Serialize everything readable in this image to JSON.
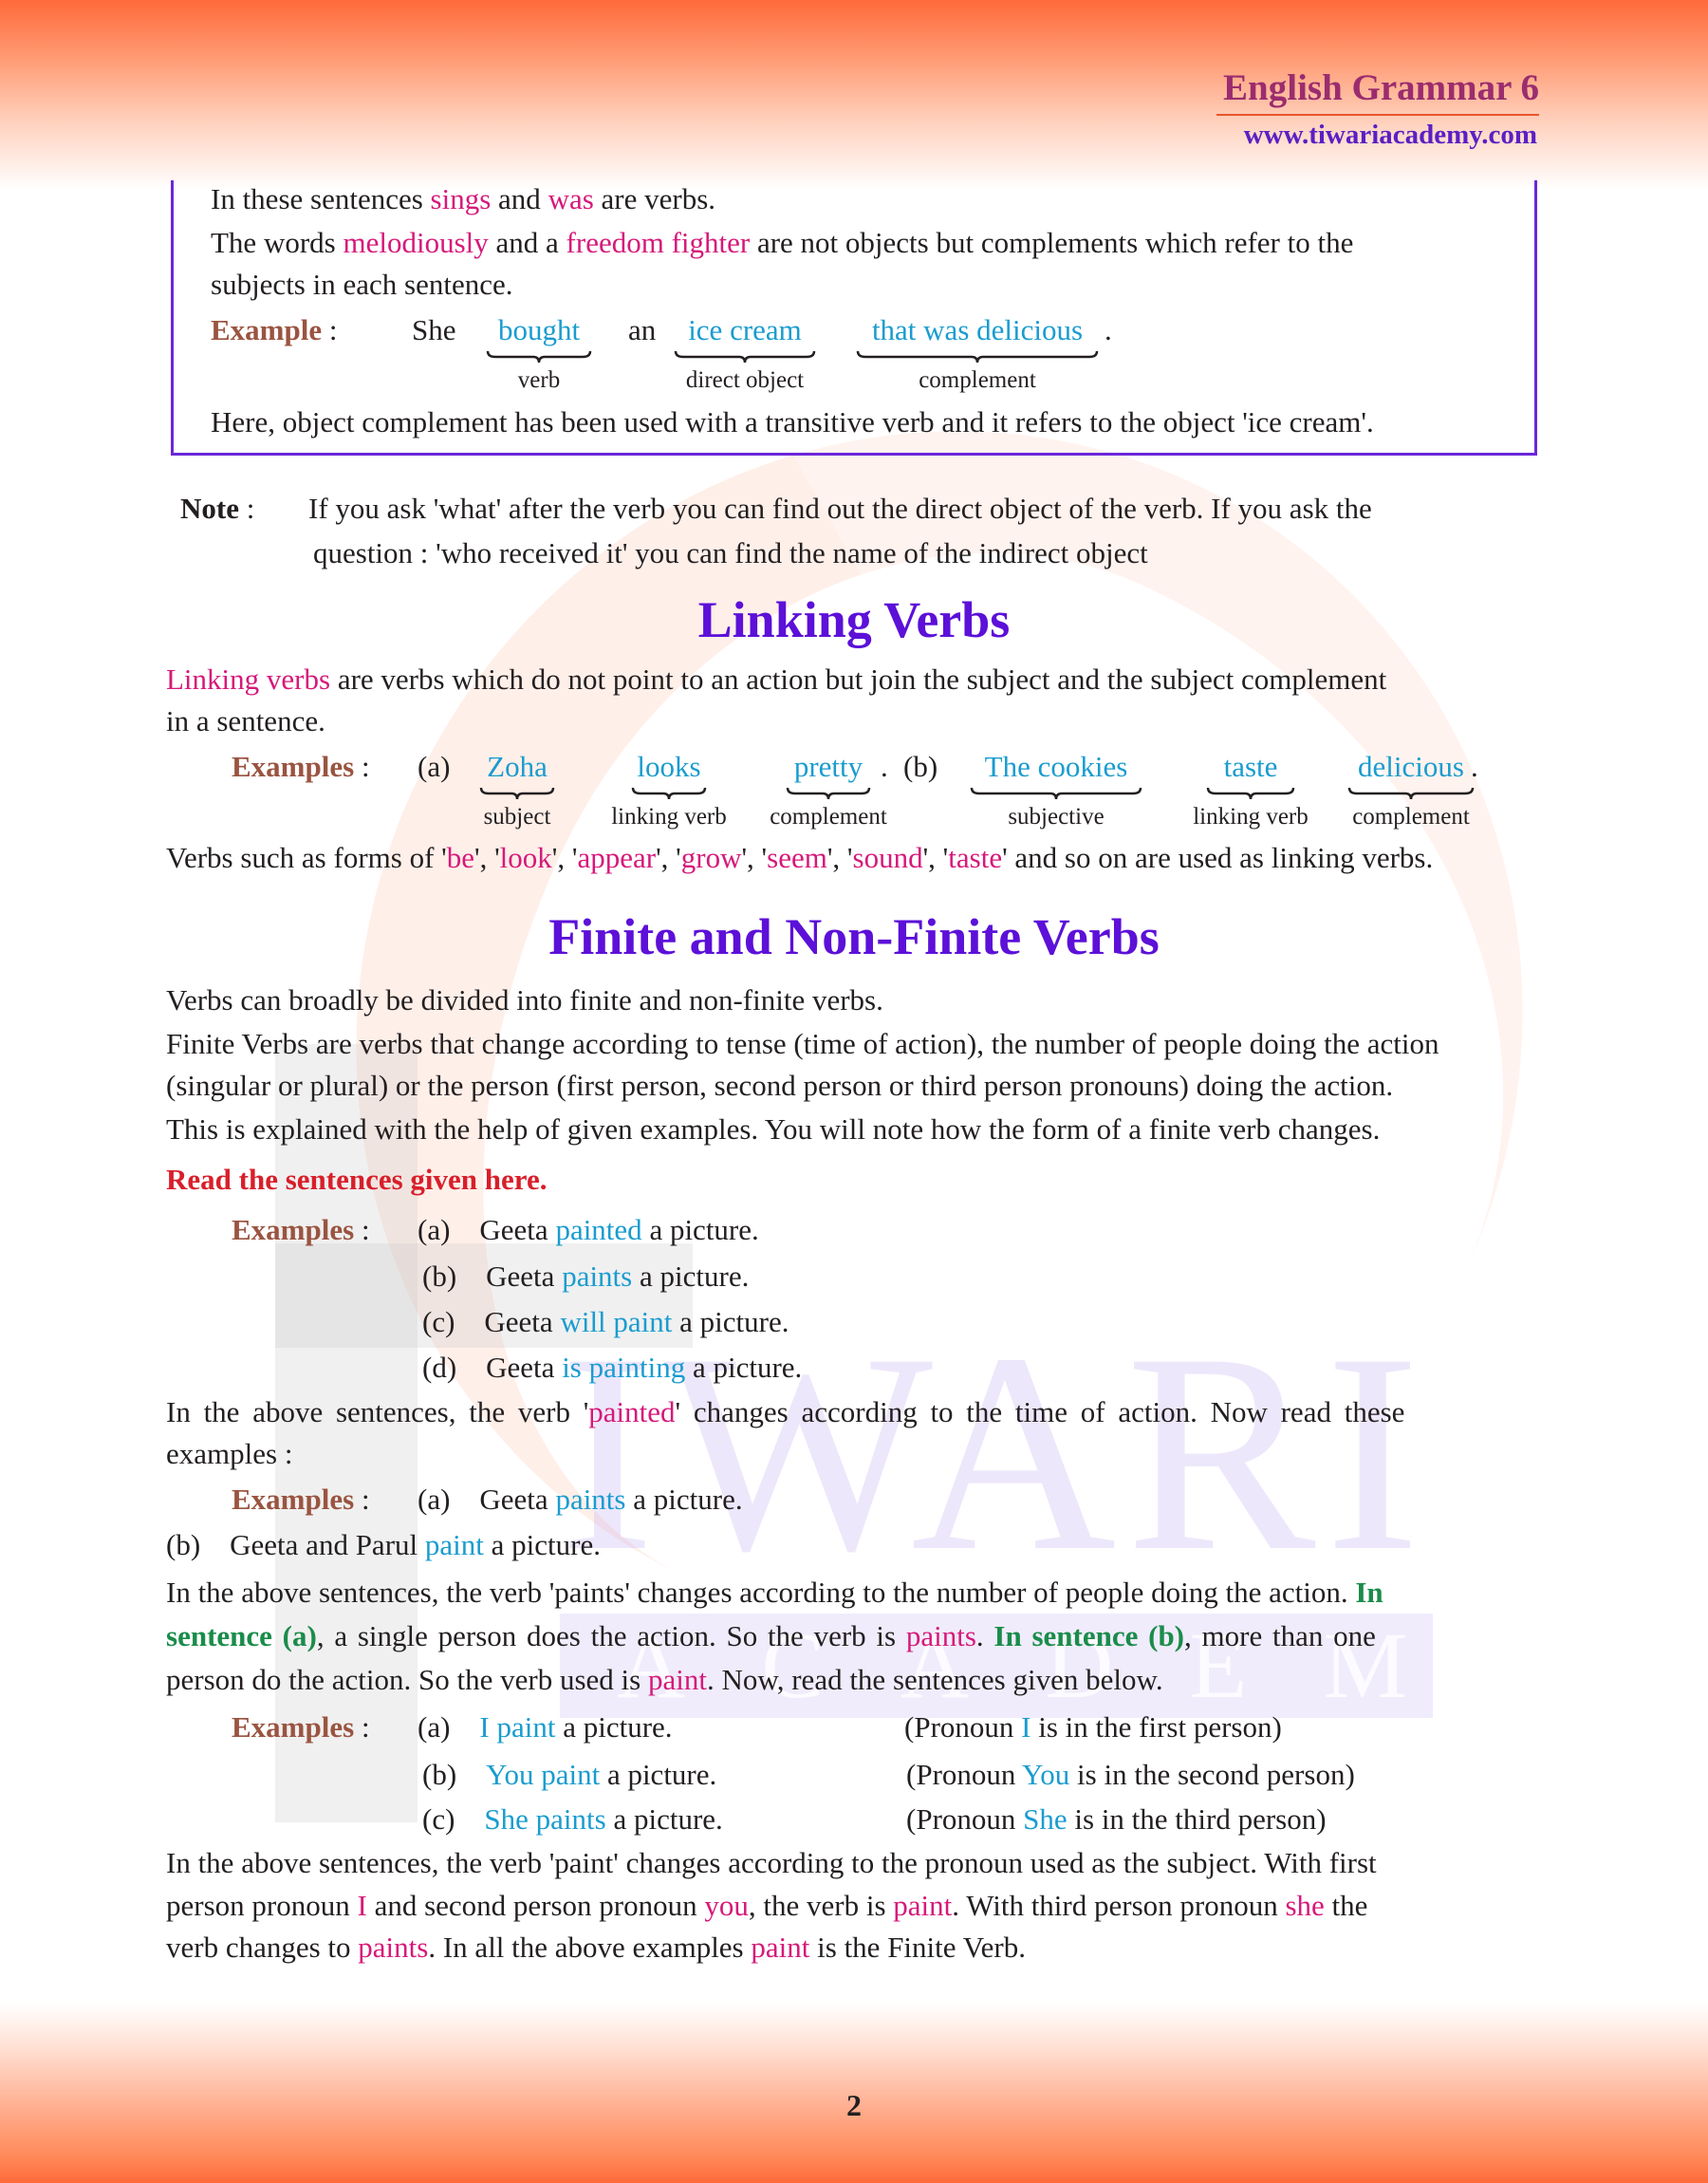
{
  "header": {
    "title": "English Grammar 6",
    "url": "www.tiwariacademy.com"
  },
  "watermark": {
    "word": "IWARI",
    "sub": "ACADEMY"
  },
  "box": {
    "line1": {
      "pre": "In these sentences ",
      "w1": "sings",
      "mid": " and ",
      "w2": "was",
      "post": " are verbs."
    },
    "line2": {
      "pre": "The words ",
      "w1": "melodiously",
      "mid": " and a ",
      "w2": "freedom fighter",
      "post": " are not objects but complements which refer to the"
    },
    "line3": "subjects in each sentence.",
    "example": {
      "label": "Example",
      "colon": ":",
      "subject": "She",
      "article": "an",
      "period": ".",
      "parts": [
        {
          "word": "bought",
          "label": "verb"
        },
        {
          "word": "ice cream",
          "label": "direct object"
        },
        {
          "word": "that was delicious",
          "label": "complement"
        }
      ]
    },
    "line4": "Here, object complement has been used with a transitive verb and it refers to the object 'ice cream'."
  },
  "note": {
    "label": "Note",
    "colon": ":",
    "line1": "If you ask 'what' after the verb you can find out the direct object of the verb. If you ask the",
    "line2": "question : 'who received it' you can find the name of the indirect object"
  },
  "linking": {
    "heading": "Linking Verbs",
    "intro": {
      "term": "Linking verbs",
      "rest1": " are verbs which do not point to an action but join the subject and the subject complement",
      "rest2": "in a sentence."
    },
    "examples_label": "Examples",
    "colon": ":",
    "a_marker": "(a)",
    "b_marker": "(b)",
    "period": ".",
    "a_parts": [
      {
        "word": "Zoha",
        "label": "subject"
      },
      {
        "word": "looks",
        "label": "linking verb"
      },
      {
        "word": "pretty",
        "label": "complement"
      }
    ],
    "b_parts": [
      {
        "word": "The cookies",
        "label": "subjective"
      },
      {
        "word": "taste",
        "label": "linking verb"
      },
      {
        "word": "delicious",
        "label": "complement"
      }
    ],
    "forms": {
      "pre": "Verbs such as forms of ",
      "items": [
        "be",
        "look",
        "appear",
        "grow",
        "seem",
        "sound",
        "taste"
      ],
      "post": " and so on are used as linking verbs."
    }
  },
  "finite": {
    "heading": "Finite and Non-Finite Verbs",
    "p1": "Verbs can broadly be divided into finite and non-finite verbs.",
    "p2a": "Finite Verbs are verbs that change according to tense (time of action), the number of people doing the action",
    "p2b": "(singular or plural) or the person (first person, second person or third person pronouns) doing the action.",
    "p3": "This is explained with the help of given examples. You will note how the form of a finite verb changes.",
    "read": "Read the sentences given here.",
    "examples_label": "Examples",
    "colon": ":",
    "set1": [
      {
        "marker": "(a)",
        "pre": "Geeta ",
        "verb": "painted",
        "post": " a picture."
      },
      {
        "marker": "(b)",
        "pre": "Geeta ",
        "verb": "paints",
        "post": " a picture."
      },
      {
        "marker": "(c)",
        "pre": "Geeta ",
        "verb": "will paint",
        "post": " a picture."
      },
      {
        "marker": "(d)",
        "pre": "Geeta ",
        "verb": "is painting",
        "post": " a picture."
      }
    ],
    "after1a": {
      "pre": "In the above sentences, the verb '",
      "verb": "painted",
      "post": "' changes according to the time of action. Now read these"
    },
    "after1b": "examples :",
    "set2": [
      {
        "marker": "(a)",
        "pre": "Geeta ",
        "verb": "paints",
        "post": " a picture."
      },
      {
        "marker": "(b)",
        "pre": "Geeta and Parul ",
        "verb": "paint",
        "post": " a picture."
      }
    ],
    "after2a": {
      "pre": "In the above sentences, the verb 'paints' changes according to the number of people doing the action. ",
      "bold": "In"
    },
    "after2b": {
      "bold1": "sentence (a)",
      "mid1": ", a single person does the action. So the verb is ",
      "verb1": "paints",
      "mid2": ". ",
      "bold2": "In sentence (b)",
      "post": ", more than one"
    },
    "after2c": {
      "pre": "person do the action. So the verb used is ",
      "verb": "paint",
      "post": ". Now, read the sentences given below."
    },
    "set3": [
      {
        "marker": "(a)",
        "verb": "I paint",
        "post": " a picture.",
        "note_pre": "(Pronoun ",
        "note_pron": "I",
        "note_post": " is in the first person)"
      },
      {
        "marker": "(b)",
        "verb": "You paint",
        "post": " a picture.",
        "note_pre": "(Pronoun ",
        "note_pron": "You",
        "note_post": " is in the second person)"
      },
      {
        "marker": "(c)",
        "verb": "She paints",
        "post": " a picture.",
        "note_pre": "(Pronoun ",
        "note_pron": "She",
        "note_post": " is in the third person)"
      }
    ],
    "after3a": "In the above sentences, the verb 'paint' changes according to the pronoun used as the subject. With first",
    "after3b": {
      "t1": "person pronoun ",
      "p1": "I",
      "t2": " and second person pronoun ",
      "p2": "you",
      "t3": ", the verb is ",
      "p3": "paint",
      "t4": ". With third person pronoun ",
      "p4": "she",
      "t5": " the"
    },
    "after3c": {
      "t1": "verb changes to ",
      "p1": "paints",
      "t2": ". In all the above examples ",
      "p2": "paint",
      "t3": " is the Finite Verb."
    }
  },
  "footer": {
    "page_number": "2"
  },
  "colors": {
    "heading": "#5c10d8",
    "highlight_pink": "#d6197a",
    "highlight_blue": "#1a9ccf",
    "example_label": "#9a5440",
    "green_bold": "#1a8c4a",
    "red_bold": "#d81f2a",
    "box_border": "#6c27d9",
    "band": "#ff6a3a"
  }
}
